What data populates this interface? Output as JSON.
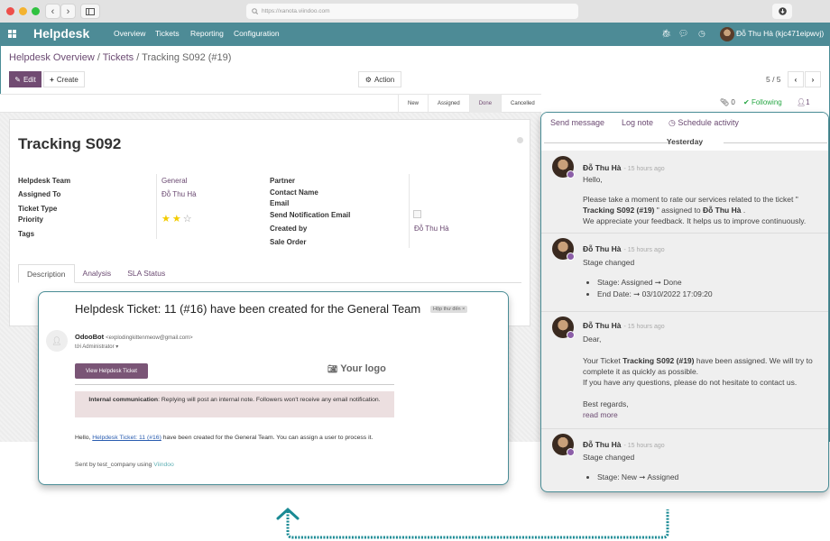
{
  "browser": {
    "url": "https://xanota.viindoo.com",
    "colors": {
      "red": "#ee4f4a",
      "yellow": "#f4b330",
      "green": "#2fc240"
    }
  },
  "navbar": {
    "app_name": "Helpdesk",
    "menu": [
      "Overview",
      "Tickets",
      "Reporting",
      "Configuration"
    ],
    "user": "Đỗ Thu Hà (kjc471eipwvj)",
    "icons": [
      "bug-icon",
      "chat-icon",
      "clock-icon"
    ]
  },
  "breadcrumb": {
    "items": [
      "Helpdesk Overview",
      "Tickets"
    ],
    "current": "Tracking S092 (#19)",
    "sep": "/"
  },
  "toolbar": {
    "edit": "Edit",
    "create": "Create",
    "action": "Action",
    "pager": "5 / 5"
  },
  "stages": {
    "items": [
      "New",
      "Assigned",
      "Done",
      "Cancelled"
    ],
    "active": "Done"
  },
  "chatter_counts": {
    "attachments": "0",
    "following": "Following",
    "followers": "1"
  },
  "ticket": {
    "title": "Tracking S092",
    "left_fields": [
      {
        "label": "Helpdesk Team",
        "value": "General"
      },
      {
        "label": "Assigned To",
        "value": "Đỗ Thu Hà"
      },
      {
        "label": "Ticket Type",
        "value": ""
      },
      {
        "label": "Priority",
        "value": ""
      },
      {
        "label": "Tags",
        "value": ""
      }
    ],
    "priority_stars": 2,
    "priority_max": 3,
    "right_fields": [
      {
        "label": "Partner",
        "value": ""
      },
      {
        "label": "Contact Name",
        "value": ""
      },
      {
        "label": "Email",
        "value": ""
      },
      {
        "label": "Send Notification Email",
        "value": ""
      },
      {
        "label": "Created by",
        "value": "Đỗ Thu Hà"
      },
      {
        "label": "Sale Order",
        "value": ""
      }
    ],
    "send_notification_checked": false,
    "tabs": [
      "Description",
      "Analysis",
      "SLA Status"
    ],
    "active_tab": "Description"
  },
  "email": {
    "subject": "Helpdesk Ticket: 11 (#16) have been created for the General Team",
    "inbox_tag": "Hộp thư đến ×",
    "sender_name": "OdooBot",
    "sender_email": "<explodingkittenmeow@gmail.com>",
    "recipient": "tới Administrator ▾",
    "view_button": "View Helpdesk Ticket",
    "logo_text": "Your logo",
    "note_bold": "Internal communication",
    "note_text": ": Replying will post an internal note. Followers won't receive any email notification.",
    "hello_prefix": "Hello, ",
    "hello_link": "Helpdesk Ticket: 11 (#16)",
    "hello_suffix": " have been created for the General Team. You can assign a user to process it.",
    "sent_by_prefix": "Sent by test_company using ",
    "sent_by_link": "Viindoo"
  },
  "chatter": {
    "actions": [
      "Send message",
      "Log note",
      "Schedule activity"
    ],
    "date_separator": "Yesterday",
    "messages": [
      {
        "author": "Đỗ Thu Hà",
        "time": "- 15 hours ago",
        "lines": [
          "Hello,",
          "",
          "Please take a moment to rate our services related to the ticket \"",
          "Tracking S092 (#19)",
          " \" assigned to ",
          "Đỗ Thu Hà",
          " .",
          "We appreciate your feedback. It helps us to improve continuously."
        ]
      },
      {
        "author": "Đỗ Thu Hà",
        "time": "- 15 hours ago",
        "title": "Stage changed",
        "changes": [
          "Stage: Assigned ➞ Done",
          "End Date: ➞ 03/10/2022 17:09:20"
        ]
      },
      {
        "author": "Đỗ Thu Hà",
        "time": "- 15 hours ago",
        "greeting": "Dear,",
        "p1_prefix": "Your Ticket ",
        "p1_bold": "Tracking S092 (#19)",
        "p1_suffix": " have been assigned. We will try to complete it as quickly as possible.",
        "p2": "If you have any questions, please do not hesitate to contact us.",
        "closing": "Best regards,",
        "read_more": "read more"
      },
      {
        "author": "Đỗ Thu Hà",
        "time": "- 15 hours ago",
        "title": "Stage changed",
        "changes": [
          "Stage: New ➞ Assigned"
        ]
      }
    ]
  },
  "colors": {
    "brand": "#4d8b96",
    "primary": "#714b72",
    "link": "#6b4a72",
    "following": "#28a745",
    "star": "#f3cc00",
    "accent_arrow": "#1a8a94"
  }
}
